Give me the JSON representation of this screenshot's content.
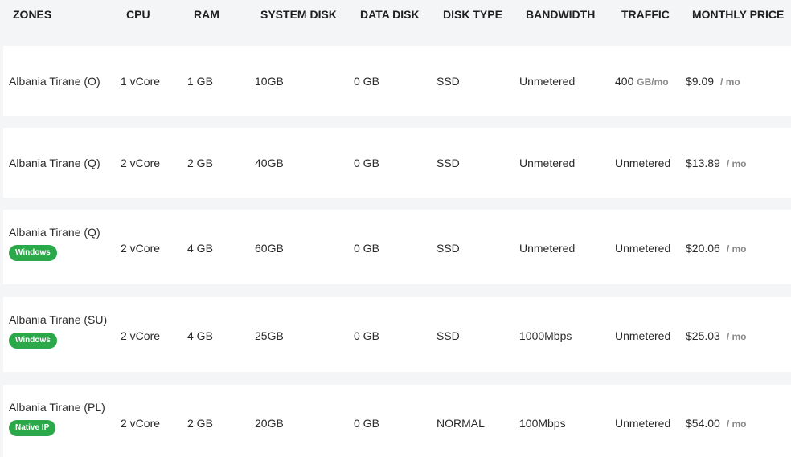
{
  "headers": {
    "zones": "ZONES",
    "cpu": "CPU",
    "ram": "RAM",
    "system_disk": "SYSTEM DISK",
    "data_disk": "DATA DISK",
    "disk_type": "DISK TYPE",
    "bandwidth": "BANDWIDTH",
    "traffic": "TRAFFIC",
    "monthly_price": "MONTHLY PRICE"
  },
  "rows": [
    {
      "zone": "Albania Tirane (O)",
      "badge": "",
      "cpu": "1 vCore",
      "ram": "1 GB",
      "system_disk": "10GB",
      "data_disk": "0 GB",
      "disk_type": "SSD",
      "bandwidth": "Unmetered",
      "traffic_value": "400",
      "traffic_unit": "GB/mo",
      "price": "$9.09",
      "price_unit": "/ mo"
    },
    {
      "zone": "Albania Tirane (Q)",
      "badge": "",
      "cpu": "2 vCore",
      "ram": "2 GB",
      "system_disk": "40GB",
      "data_disk": "0 GB",
      "disk_type": "SSD",
      "bandwidth": "Unmetered",
      "traffic_value": "Unmetered",
      "traffic_unit": "",
      "price": "$13.89",
      "price_unit": "/ mo"
    },
    {
      "zone": "Albania Tirane (Q)",
      "badge": "Windows",
      "cpu": "2 vCore",
      "ram": "4 GB",
      "system_disk": "60GB",
      "data_disk": "0 GB",
      "disk_type": "SSD",
      "bandwidth": "Unmetered",
      "traffic_value": "Unmetered",
      "traffic_unit": "",
      "price": "$20.06",
      "price_unit": "/ mo"
    },
    {
      "zone": "Albania Tirane (SU)",
      "badge": "Windows",
      "cpu": "2 vCore",
      "ram": "4 GB",
      "system_disk": "25GB",
      "data_disk": "0 GB",
      "disk_type": "SSD",
      "bandwidth": "1000Mbps",
      "traffic_value": "Unmetered",
      "traffic_unit": "",
      "price": "$25.03",
      "price_unit": "/ mo"
    },
    {
      "zone": "Albania Tirane (PL)",
      "badge": "Native IP",
      "cpu": "2 vCore",
      "ram": "2 GB",
      "system_disk": "20GB",
      "data_disk": "0 GB",
      "disk_type": "NORMAL",
      "bandwidth": "100Mbps",
      "traffic_value": "Unmetered",
      "traffic_unit": "",
      "price": "$54.00",
      "price_unit": "/ mo"
    }
  ],
  "colors": {
    "badge_green": "#2ba84a",
    "unit_gray": "#8a8a8a",
    "row_bg": "#ffffff",
    "page_bg": "#f4f5f7"
  }
}
